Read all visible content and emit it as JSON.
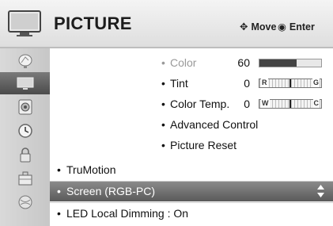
{
  "header": {
    "title": "PICTURE",
    "hint_move": "Move",
    "hint_enter": "Enter",
    "move_icon": "four-way-arrow-icon",
    "enter_icon": "dot-circle-icon"
  },
  "sidebar": {
    "items": [
      {
        "icon": "satellite-dish-icon",
        "active": false
      },
      {
        "icon": "tv-picture-icon",
        "active": true
      },
      {
        "icon": "speaker-audio-icon",
        "active": false
      },
      {
        "icon": "clock-icon",
        "active": false
      },
      {
        "icon": "lock-icon",
        "active": false
      },
      {
        "icon": "toolbox-option-icon",
        "active": false
      },
      {
        "icon": "globe-network-icon",
        "active": false
      }
    ]
  },
  "menu": {
    "color": {
      "label": "Color",
      "value": "60",
      "level": 0.6,
      "dimmed": true
    },
    "tint": {
      "label": "Tint",
      "value": "0",
      "left": "R",
      "right": "G",
      "position": 0.5
    },
    "color_temp": {
      "label": "Color Temp.",
      "value": "0",
      "left": "W",
      "right": "C",
      "position": 0.5
    },
    "advanced": {
      "label": "Advanced Control"
    },
    "reset": {
      "label": "Picture Reset"
    },
    "trumotion": {
      "label": "TruMotion"
    },
    "screen": {
      "label": "Screen (RGB-PC)"
    },
    "led": {
      "label": "LED Local Dimming",
      "value": "On"
    }
  },
  "bullet": "•",
  "colors": {
    "accent_selected": "#5a5a5a",
    "sidebar": "#cfcfcf"
  }
}
